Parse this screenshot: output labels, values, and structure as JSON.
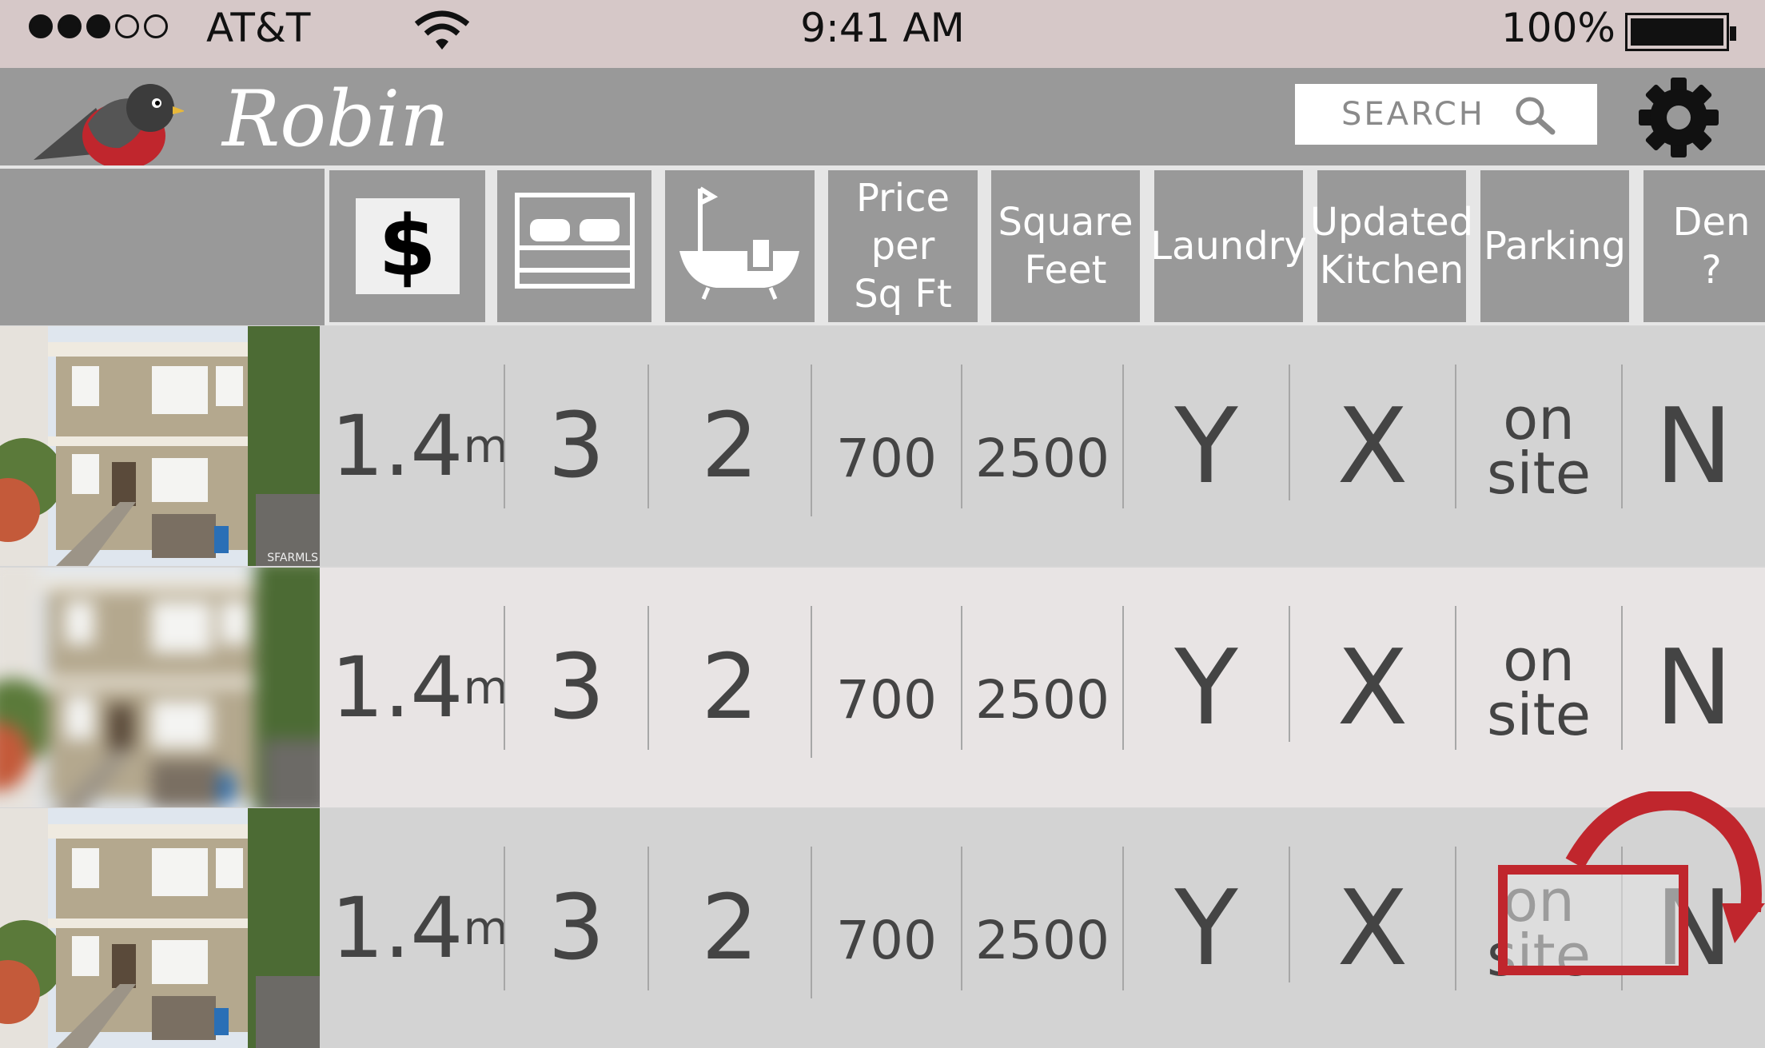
{
  "status_bar": {
    "carrier": "AT&T",
    "time": "9:41 AM",
    "battery": "100%",
    "signal_bars": 3,
    "signal_total": 5
  },
  "app": {
    "title": "Robin",
    "search_placeholder": "SEARCH"
  },
  "columns": [
    {
      "kind": "icon",
      "icon": "dollar-icon",
      "glyph": "$"
    },
    {
      "kind": "icon",
      "icon": "bed-icon"
    },
    {
      "kind": "icon",
      "icon": "bathtub-icon"
    },
    {
      "kind": "text",
      "label": "Price\nper\nSq Ft"
    },
    {
      "kind": "text",
      "label": "Square\nFeet"
    },
    {
      "kind": "text",
      "label": "Laundry"
    },
    {
      "kind": "text",
      "label": "Updated\nKitchen"
    },
    {
      "kind": "text",
      "label": "Parking"
    },
    {
      "kind": "text",
      "label": "Den ?"
    }
  ],
  "listings": [
    {
      "price_num": "1.4",
      "price_unit": "m",
      "beds": "3",
      "baths": "2",
      "price_sqft": "700",
      "sqft": "2500",
      "laundry": "Y",
      "kitchen": "X",
      "parking": "on\nsite",
      "den": "N",
      "photo_credit": "SFARMLS"
    },
    {
      "price_num": "1.4",
      "price_unit": "m",
      "beds": "3",
      "baths": "2",
      "price_sqft": "700",
      "sqft": "2500",
      "laundry": "Y",
      "kitchen": "X",
      "parking": "on\nsite",
      "den": "N"
    },
    {
      "price_num": "1.4",
      "price_unit": "m",
      "beds": "3",
      "baths": "2",
      "price_sqft": "700",
      "sqft": "2500",
      "laundry": "Y",
      "kitchen": "X",
      "parking": "on\nsite",
      "den": "N"
    }
  ],
  "colors": {
    "accent": "#c0262d",
    "header_gray": "#999999",
    "status_bg": "#d6c8c8"
  }
}
